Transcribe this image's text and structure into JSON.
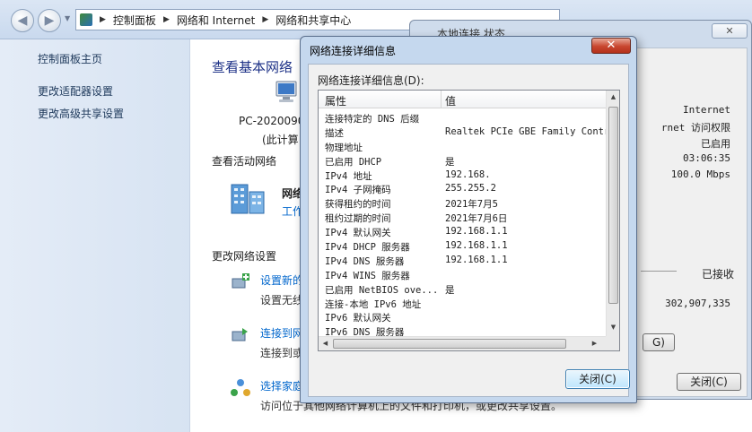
{
  "breadcrumb": [
    "控制面板",
    "网络和 Internet",
    "网络和共享中心"
  ],
  "sidebar": {
    "items": [
      {
        "label": "控制面板主页"
      },
      {
        "label": "更改适配器设置"
      },
      {
        "label": "更改高级共享设置"
      }
    ]
  },
  "main": {
    "title": "查看基本网络",
    "pc_name": "PC-2020090",
    "pc_sub": "(此计算",
    "active_networks_label": "查看活动网络",
    "network_name": "网络",
    "network_type": "工作",
    "change_settings_label": "更改网络设置",
    "tasks": [
      {
        "link": "设置新的",
        "desc": "设置无线"
      },
      {
        "link": "连接到网",
        "desc": "连接到或"
      },
      {
        "link": "选择家庭",
        "desc": "访问位于其他网络计算机上的文件和打印机，或更改共享设置。"
      }
    ]
  },
  "status_window": {
    "title": "本地连接 状态",
    "values": [
      "Internet",
      "rnet 访问权限",
      "已启用",
      "03:06:35",
      "100.0 Mbps"
    ],
    "received_label": "已接收",
    "received_bytes": "302,907,335",
    "partial_button": "G)",
    "close_button": "关闭(C)"
  },
  "dialog": {
    "title": "网络连接详细信息",
    "close_glyph": "✕",
    "list_label": "网络连接详细信息(D):",
    "columns": [
      "属性",
      "值"
    ],
    "rows": [
      {
        "prop": "连接特定的 DNS 后缀",
        "value": ""
      },
      {
        "prop": "描述",
        "value": "Realtek PCIe GBE Family Contro"
      },
      {
        "prop": "物理地址",
        "value": ""
      },
      {
        "prop": "已启用 DHCP",
        "value": "是"
      },
      {
        "prop": "IPv4 地址",
        "value": "192.168."
      },
      {
        "prop": "IPv4 子网掩码",
        "value": "255.255.2"
      },
      {
        "prop": "获得租约的时间",
        "value": "2021年7月5"
      },
      {
        "prop": "租约过期的时间",
        "value": "2021年7月6日"
      },
      {
        "prop": "IPv4 默认网关",
        "value": "192.168.1.1"
      },
      {
        "prop": "IPv4 DHCP 服务器",
        "value": "192.168.1.1"
      },
      {
        "prop": "IPv4 DNS 服务器",
        "value": "192.168.1.1"
      },
      {
        "prop": "IPv4 WINS 服务器",
        "value": ""
      },
      {
        "prop": "已启用 NetBIOS ove...",
        "value": "是"
      },
      {
        "prop": "连接-本地 IPv6 地址",
        "value": ""
      },
      {
        "prop": "IPv6 默认网关",
        "value": ""
      },
      {
        "prop": "IPv6 DNS 服务器",
        "value": ""
      }
    ],
    "close_button": "关闭(C)"
  },
  "colors": {
    "link": "#0066cc",
    "title_blue": "#1e3287",
    "close_red": "#c8462f"
  }
}
